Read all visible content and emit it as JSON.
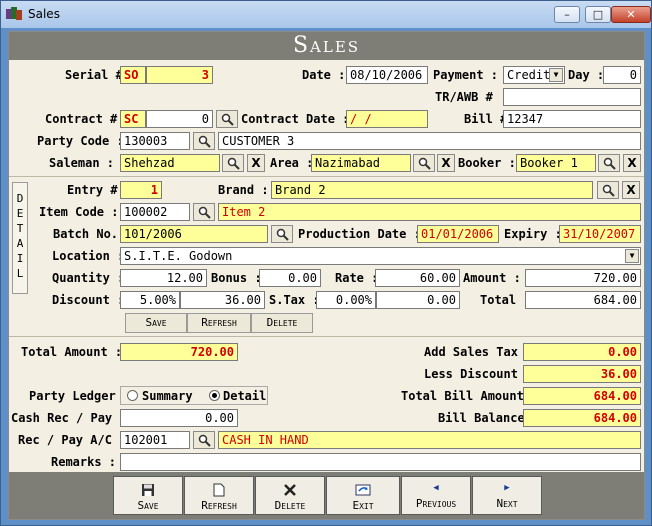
{
  "window": {
    "title": "Sales",
    "min": "–",
    "max": "□",
    "close": "✕"
  },
  "header": {
    "title": "Sales"
  },
  "serial": {
    "label": "Serial #",
    "prefix": "SO",
    "number": "3"
  },
  "date": {
    "label": "Date :",
    "value": "08/10/2006"
  },
  "payment": {
    "label": "Payment :",
    "value": "Credit"
  },
  "day": {
    "label": "Day :",
    "value": "0"
  },
  "tr_awb": {
    "label": "TR/AWB #",
    "value": ""
  },
  "contract": {
    "label": "Contract #",
    "prefix": "SC",
    "number": "0"
  },
  "contract_date": {
    "label": "Contract Date :",
    "value": " /  /"
  },
  "bill": {
    "label": "Bill #",
    "value": "12347"
  },
  "party": {
    "label": "Party Code :",
    "code": "130003",
    "name": "CUSTOMER 3"
  },
  "saleman": {
    "label": "Saleman :",
    "value": "Shehzad"
  },
  "area": {
    "label": "Area :",
    "value": "Nazimabad"
  },
  "booker": {
    "label": "Booker :",
    "value": "Booker 1"
  },
  "detail_tab": {
    "letters": [
      "D",
      "E",
      "T",
      "A",
      "I",
      "L"
    ]
  },
  "entry": {
    "label": "Entry #",
    "value": "1"
  },
  "brand": {
    "label": "Brand :",
    "value": "Brand 2"
  },
  "item": {
    "label": "Item Code :",
    "code": "100002",
    "name": "Item 2"
  },
  "batch": {
    "label": "Batch No.",
    "value": "101/2006"
  },
  "production_date": {
    "label": "Production Date :",
    "value": "01/01/2006"
  },
  "expiry": {
    "label": "Expiry :",
    "value": "31/10/2007"
  },
  "location": {
    "label": "Location :",
    "value": "S.I.T.E. Godown"
  },
  "quantity": {
    "label": "Quantity :",
    "value": "12.00"
  },
  "bonus": {
    "label": "Bonus :",
    "value": "0.00"
  },
  "rate": {
    "label": "Rate :",
    "value": "60.00"
  },
  "amount": {
    "label": "Amount :",
    "value": "720.00"
  },
  "discount": {
    "label": "Discount :",
    "percent": "5.00%",
    "value": "36.00"
  },
  "stax": {
    "label": "S.Tax :",
    "percent": "0.00%",
    "value": "0.00"
  },
  "total": {
    "label": "Total :",
    "value": "684.00"
  },
  "detail_buttons": {
    "save": "Save",
    "refresh": "Refresh",
    "delete": "Delete"
  },
  "total_amount": {
    "label": "Total Amount :",
    "value": "720.00"
  },
  "add_sales_tax": {
    "label": "Add Sales Tax :",
    "value": "0.00"
  },
  "less_discount": {
    "label": "Less Discount :",
    "value": "36.00"
  },
  "party_ledger": {
    "label": "Party Ledger :",
    "summary": "Summary",
    "detail": "Detail"
  },
  "total_bill_amount": {
    "label": "Total Bill Amount :",
    "value": "684.00"
  },
  "cash_rec": {
    "label": "Cash Rec / Pay :",
    "value": "0.00"
  },
  "bill_balance": {
    "label": "Bill Balance :",
    "value": "684.00"
  },
  "rec_pay_ac": {
    "label": "Rec / Pay A/C :",
    "code": "102001",
    "name": "CASH IN HAND"
  },
  "remarks": {
    "label": "Remarks :",
    "value": ""
  },
  "toolbar": {
    "save": "Save",
    "refresh": "Refresh",
    "delete": "Delete",
    "exit": "Exit",
    "previous": "Previous",
    "next": "Next"
  },
  "colors": {
    "field_yellow": "#ffff99",
    "red_text": "#d00000",
    "header_gray": "#7e7e76",
    "form_bg": "#f3efe3"
  }
}
